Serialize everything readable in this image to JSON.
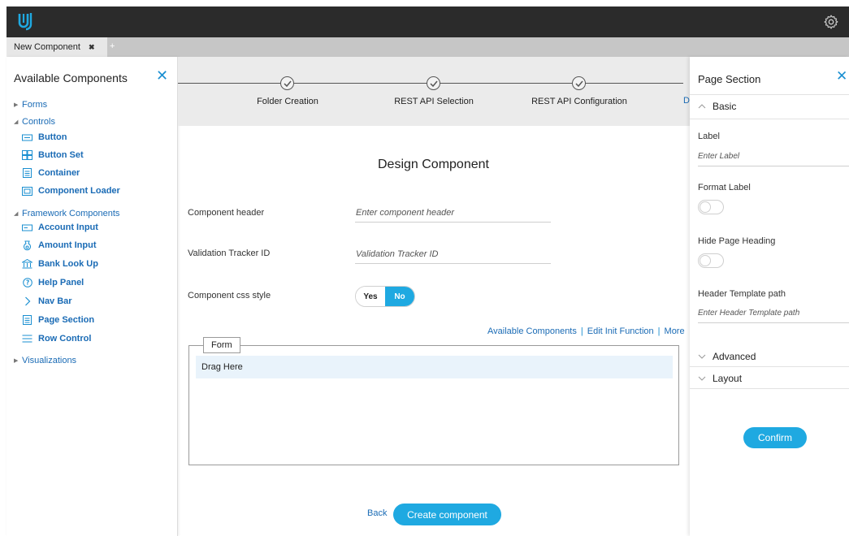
{
  "tabs": {
    "active_label": "New Component",
    "close_glyph": "✖",
    "add_glyph": "+"
  },
  "left_panel": {
    "title": "Available Components",
    "close_glyph": "✕",
    "forms": "Forms",
    "controls": "Controls",
    "controls_items": [
      "Button",
      "Button Set",
      "Container",
      "Component Loader"
    ],
    "framework": "Framework Components",
    "framework_items": [
      "Account Input",
      "Amount Input",
      "Bank Look Up",
      "Help Panel",
      "Nav Bar",
      "Page Section",
      "Row Control"
    ],
    "visualizations": "Visualizations"
  },
  "stepper": {
    "steps": [
      "Folder Creation",
      "REST API Selection",
      "REST API Configuration"
    ],
    "edge_text": "D"
  },
  "main": {
    "title": "Design Component",
    "component_header_label": "Component header",
    "component_header_placeholder": "Enter component header",
    "validation_label": "Validation Tracker ID",
    "validation_placeholder": "Validation Tracker ID",
    "css_style_label": "Component css style",
    "toggle_yes": "Yes",
    "toggle_no": "No",
    "links": [
      "Available Components",
      "Edit Init Function",
      "More"
    ],
    "form_tag": "Form",
    "drag_text": "Drag Here",
    "back": "Back",
    "create": "Create component"
  },
  "right_panel": {
    "title": "Page Section",
    "close_glyph": "✕",
    "basic": "Basic",
    "label_label": "Label",
    "label_placeholder": "Enter Label",
    "format_label": "Format Label",
    "hide_heading": "Hide Page Heading",
    "header_template_label": "Header Template path",
    "header_template_placeholder": "Enter Header Template path",
    "advanced": "Advanced",
    "layout": "Layout",
    "confirm": "Confirm"
  },
  "colors": {
    "accent": "#1fa9e1",
    "link": "#1a6bb5",
    "topbar": "#2b2b2b"
  }
}
